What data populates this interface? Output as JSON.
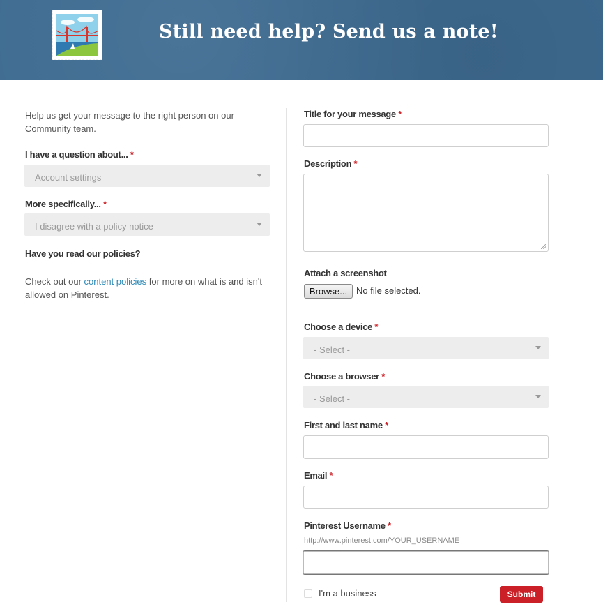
{
  "header": {
    "title": "Still need help? Send us a note!",
    "stamp_icon": "bridge-stamp-icon",
    "bg_color": "#3e6b91"
  },
  "left": {
    "intro": "Help us get your message to the right person on our Community team.",
    "topic": {
      "label": "I have a question about...",
      "required_mark": "*",
      "value": "Account settings"
    },
    "specific": {
      "label": "More specifically...",
      "required_mark": "*",
      "value": "I disagree with a policy notice"
    },
    "policies_heading": "Have you read our policies?",
    "policies_text_before": "Check out our ",
    "policies_link": "content policies",
    "policies_text_after": " for more on what is and isn't allowed on Pinterest."
  },
  "right": {
    "title_field": {
      "label": "Title for your message",
      "required_mark": "*",
      "value": ""
    },
    "description": {
      "label": "Description",
      "required_mark": "*",
      "value": ""
    },
    "attach": {
      "label": "Attach a screenshot",
      "browse_label": "Browse...",
      "status": "No file selected."
    },
    "device": {
      "label": "Choose a device",
      "required_mark": "*",
      "value": "- Select -"
    },
    "browser": {
      "label": "Choose a browser",
      "required_mark": "*",
      "value": "- Select -"
    },
    "name": {
      "label": "First and last name",
      "required_mark": "*",
      "value": ""
    },
    "email": {
      "label": "Email",
      "required_mark": "*",
      "value": ""
    },
    "username": {
      "label": "Pinterest Username",
      "required_mark": "*",
      "hint": "http://www.pinterest.com/YOUR_USERNAME",
      "value": ""
    },
    "business": {
      "label": "I'm a business",
      "checked": false
    },
    "submit_label": "Submit"
  },
  "colors": {
    "accent_red": "#cb2027",
    "link_blue": "#2e8ab8"
  }
}
